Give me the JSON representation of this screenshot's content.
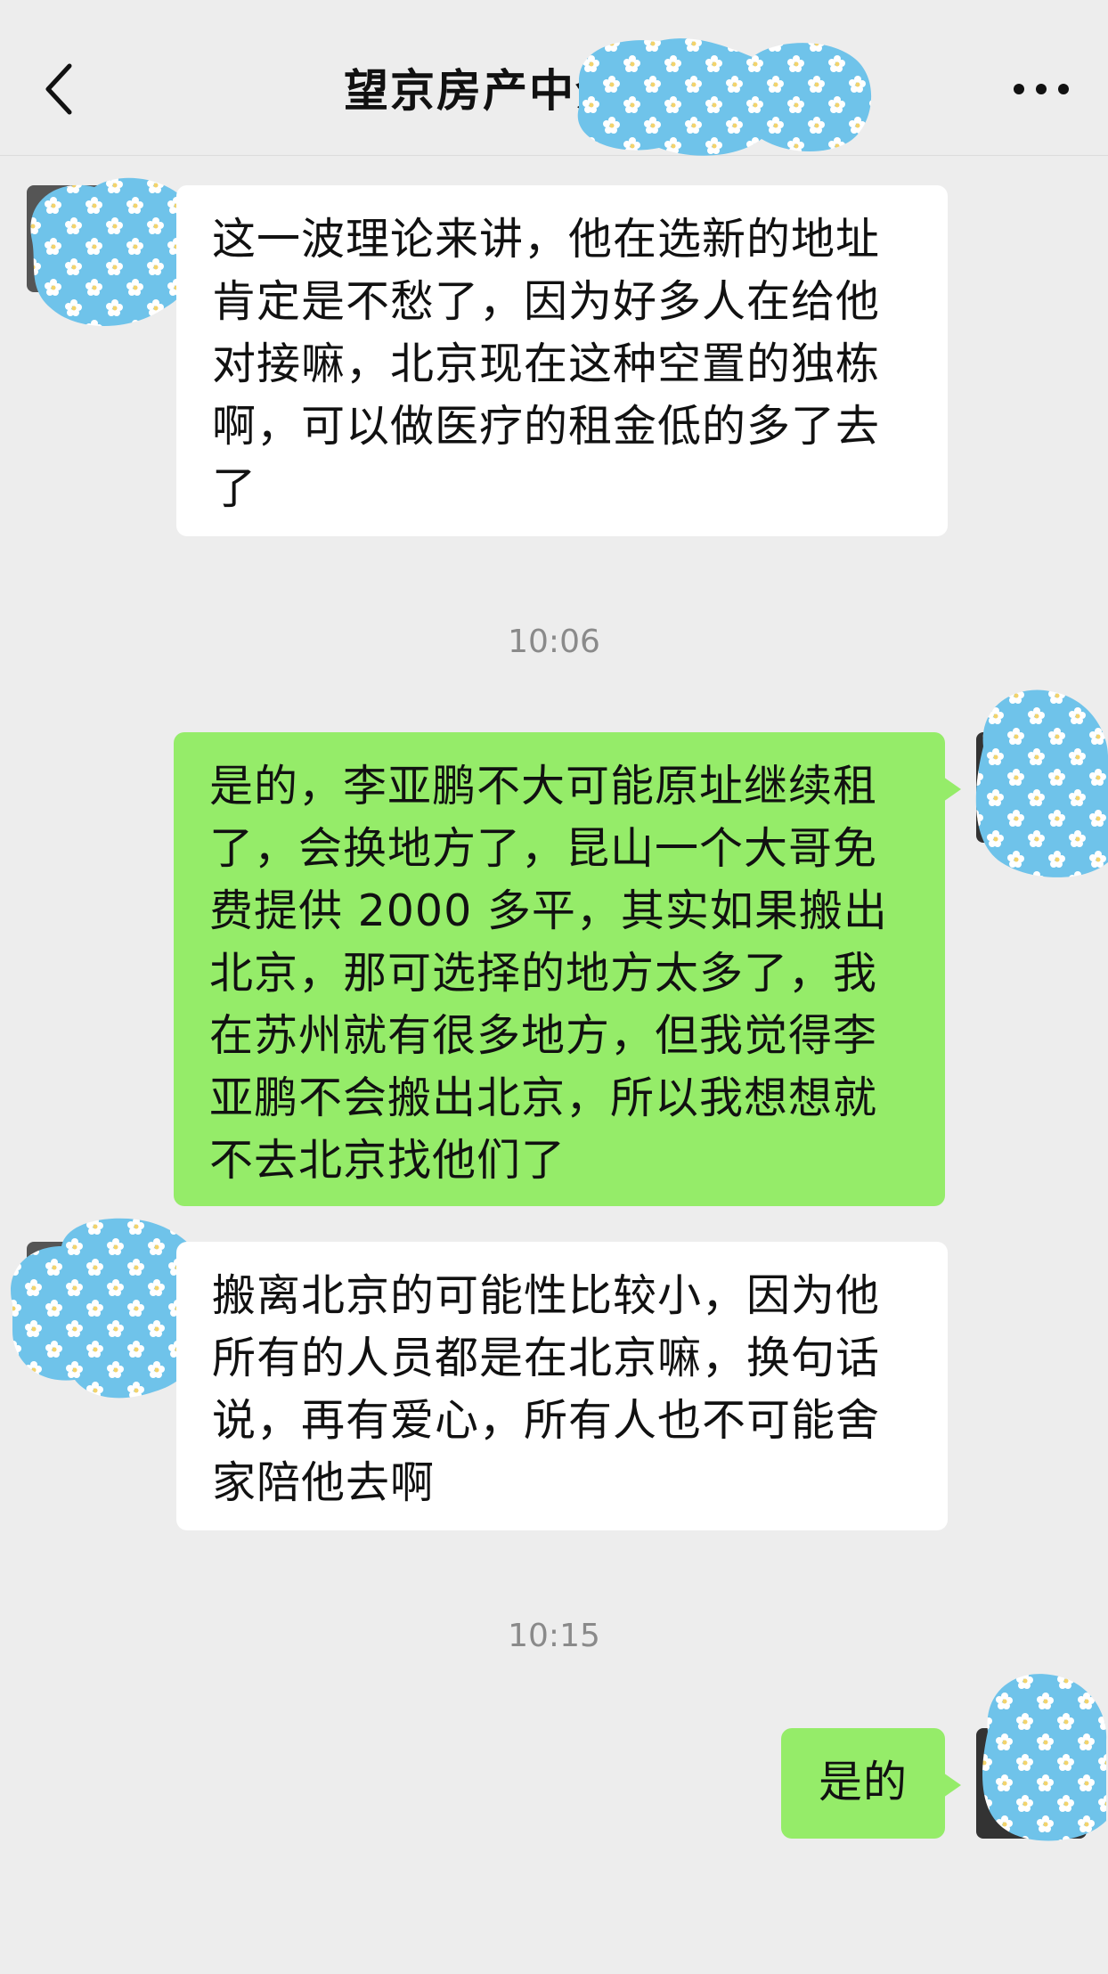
{
  "header": {
    "title": "望京房产中介",
    "back_icon": "chevron-left-icon",
    "more_icon": "more-dots-icon"
  },
  "messages": [
    {
      "side": "in",
      "text": "这一波理论来讲，他在选新的地址肯定是不愁了，因为好多人在给他对接嘛，北京现在这种空置的独栋啊，可以做医疗的租金低的多了去了"
    },
    {
      "timestamp": "10:06"
    },
    {
      "side": "out",
      "text": "是的，李亚鹏不大可能原址继续租了，会换地方了，昆山一个大哥免费提供 2000 多平，其实如果搬出北京，那可选择的地方太多了，我在苏州就有很多地方，但我觉得李亚鹏不会搬出北京，所以我想想就不去北京找他们了"
    },
    {
      "side": "in",
      "text": "搬离北京的可能性比较小，因为他所有的人员都是在北京嘛，换句话说，再有爱心，所有人也不可能舍家陪他去啊"
    },
    {
      "timestamp": "10:15"
    },
    {
      "side": "out",
      "text": "是的"
    }
  ],
  "colors": {
    "background": "#ededed",
    "incoming_bubble": "#ffffff",
    "outgoing_bubble": "#95ec69",
    "timestamp": "#8a8a8a",
    "redaction_blob": "#6fc3ea"
  }
}
